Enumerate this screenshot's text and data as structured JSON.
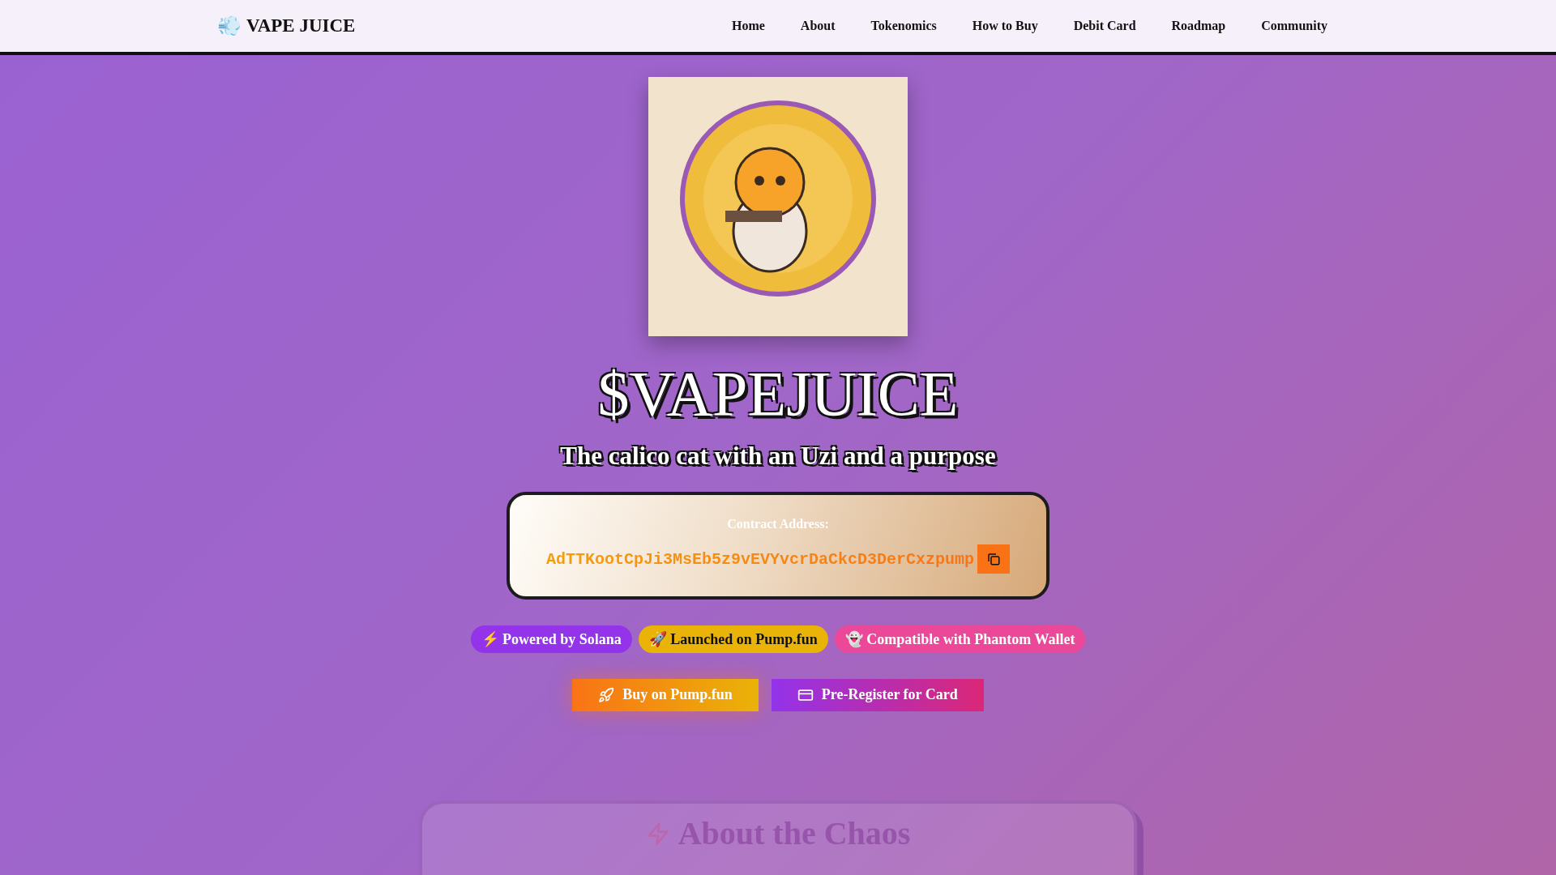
{
  "header": {
    "logo_emoji": "💨",
    "logo_text": "VAPE JUICE",
    "nav": [
      {
        "label": "Home"
      },
      {
        "label": "About"
      },
      {
        "label": "Tokenomics"
      },
      {
        "label": "How to Buy"
      },
      {
        "label": "Debit Card"
      },
      {
        "label": "Roadmap"
      },
      {
        "label": "Community"
      }
    ]
  },
  "hero": {
    "title": "$VAPEJUICE",
    "subtitle": "The calico cat with an Uzi and a purpose",
    "contract": {
      "label": "Contract Address:",
      "address": "AdTTKootCpJi3MsEb5z9vEVYvcrDaCkcD3DerCxzpump"
    },
    "badges": [
      {
        "emoji": "⚡",
        "text": "Powered by Solana",
        "color": "#9333ea"
      },
      {
        "emoji": "🚀",
        "text": "Launched on Pump.fun",
        "color": "#eab308"
      },
      {
        "emoji": "👻",
        "text": "Compatible with Phantom Wallet",
        "color": "#ec4899"
      }
    ],
    "buttons": [
      {
        "kind": "buy",
        "label": "Buy on Pump.fun"
      },
      {
        "kind": "card",
        "label": "Pre-Register for Card"
      }
    ]
  },
  "about": {
    "heading": "About the Chaos"
  }
}
